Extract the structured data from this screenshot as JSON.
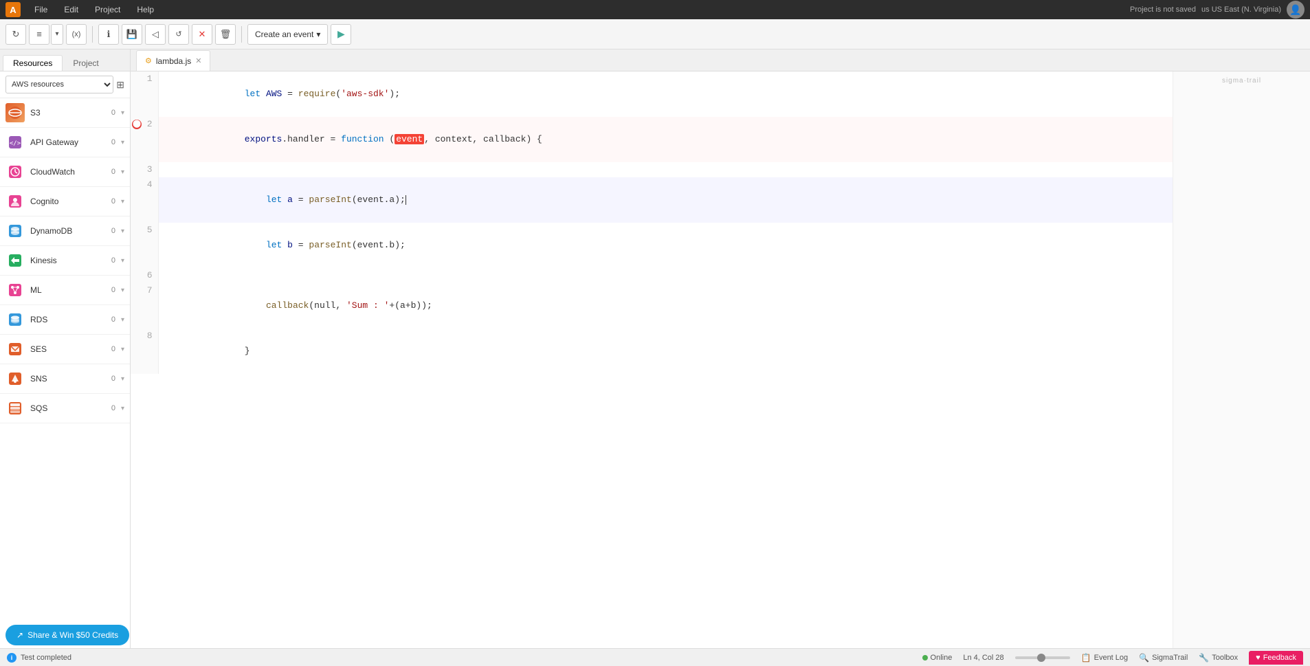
{
  "app": {
    "logo": "A",
    "menu_items": [
      "File",
      "Edit",
      "Project",
      "Help"
    ],
    "project_status": "Project is not saved",
    "region": "us US East (N. Virginia)"
  },
  "toolbar": {
    "buttons": [
      {
        "id": "refresh",
        "icon": "↻",
        "label": "Refresh"
      },
      {
        "id": "align",
        "icon": "≡",
        "label": "Align"
      },
      {
        "id": "chevron",
        "icon": "▾",
        "label": "More"
      },
      {
        "id": "variable",
        "icon": "(x)",
        "label": "Variable"
      }
    ],
    "action_buttons": [
      {
        "id": "info",
        "icon": "ℹ",
        "label": "Info"
      },
      {
        "id": "save",
        "icon": "💾",
        "label": "Save"
      },
      {
        "id": "undo",
        "icon": "◁",
        "label": "Undo"
      },
      {
        "id": "redo",
        "icon": "↺",
        "label": "Redo"
      },
      {
        "id": "close",
        "icon": "✕",
        "label": "Close"
      },
      {
        "id": "delete",
        "icon": "🗑",
        "label": "Delete"
      }
    ],
    "create_event_label": "Create an event",
    "run_icon": "▶"
  },
  "tabs": {
    "resource_tab": "Resources",
    "project_tab": "Project",
    "active_file": "lambda.js"
  },
  "sidebar": {
    "filter_label": "AWS resources",
    "services": [
      {
        "name": "S3",
        "count": "0",
        "color": "#e05e2a"
      },
      {
        "name": "API Gateway",
        "count": "0",
        "color": "#9b59b6"
      },
      {
        "name": "CloudWatch",
        "count": "0",
        "color": "#e84393"
      },
      {
        "name": "Cognito",
        "count": "0",
        "color": "#e84393"
      },
      {
        "name": "DynamoDB",
        "count": "0",
        "color": "#3498db"
      },
      {
        "name": "Kinesis",
        "count": "0",
        "color": "#27ae60"
      },
      {
        "name": "ML",
        "count": "0",
        "color": "#e84393"
      },
      {
        "name": "RDS",
        "count": "0",
        "color": "#3498db"
      },
      {
        "name": "SES",
        "count": "0",
        "color": "#e05e2a"
      },
      {
        "name": "SNS",
        "count": "0",
        "color": "#e05e2a"
      },
      {
        "name": "SQS",
        "count": "0",
        "color": "#e05e2a"
      }
    ]
  },
  "editor": {
    "filename": "lambda.js",
    "lines": [
      {
        "num": 1,
        "code": "let AWS = require('aws-sdk');",
        "error": false
      },
      {
        "num": 2,
        "code": "exports.handler = function (event, context, callback) {",
        "error": true
      },
      {
        "num": 3,
        "code": "",
        "error": false
      },
      {
        "num": 4,
        "code": "    let a = parseInt(event.a);",
        "error": false,
        "cursor": true
      },
      {
        "num": 5,
        "code": "    let b = parseInt(event.b);",
        "error": false
      },
      {
        "num": 6,
        "code": "",
        "error": false
      },
      {
        "num": 7,
        "code": "    callback(null, 'Sum : '+(a+b));",
        "error": false
      },
      {
        "num": 8,
        "code": "}",
        "error": false
      }
    ],
    "cursor_position": "Ln 4, Col 28"
  },
  "status_bar": {
    "test_completed": "Test completed",
    "online_label": "Online",
    "cursor_pos": "Ln 4, Col 28",
    "event_log": "Event Log",
    "sigmatrail": "SigmaTrail",
    "toolbox": "Toolbox",
    "feedback": "Feedback"
  },
  "share_button": {
    "label": "Share & Win $50 Credits"
  }
}
